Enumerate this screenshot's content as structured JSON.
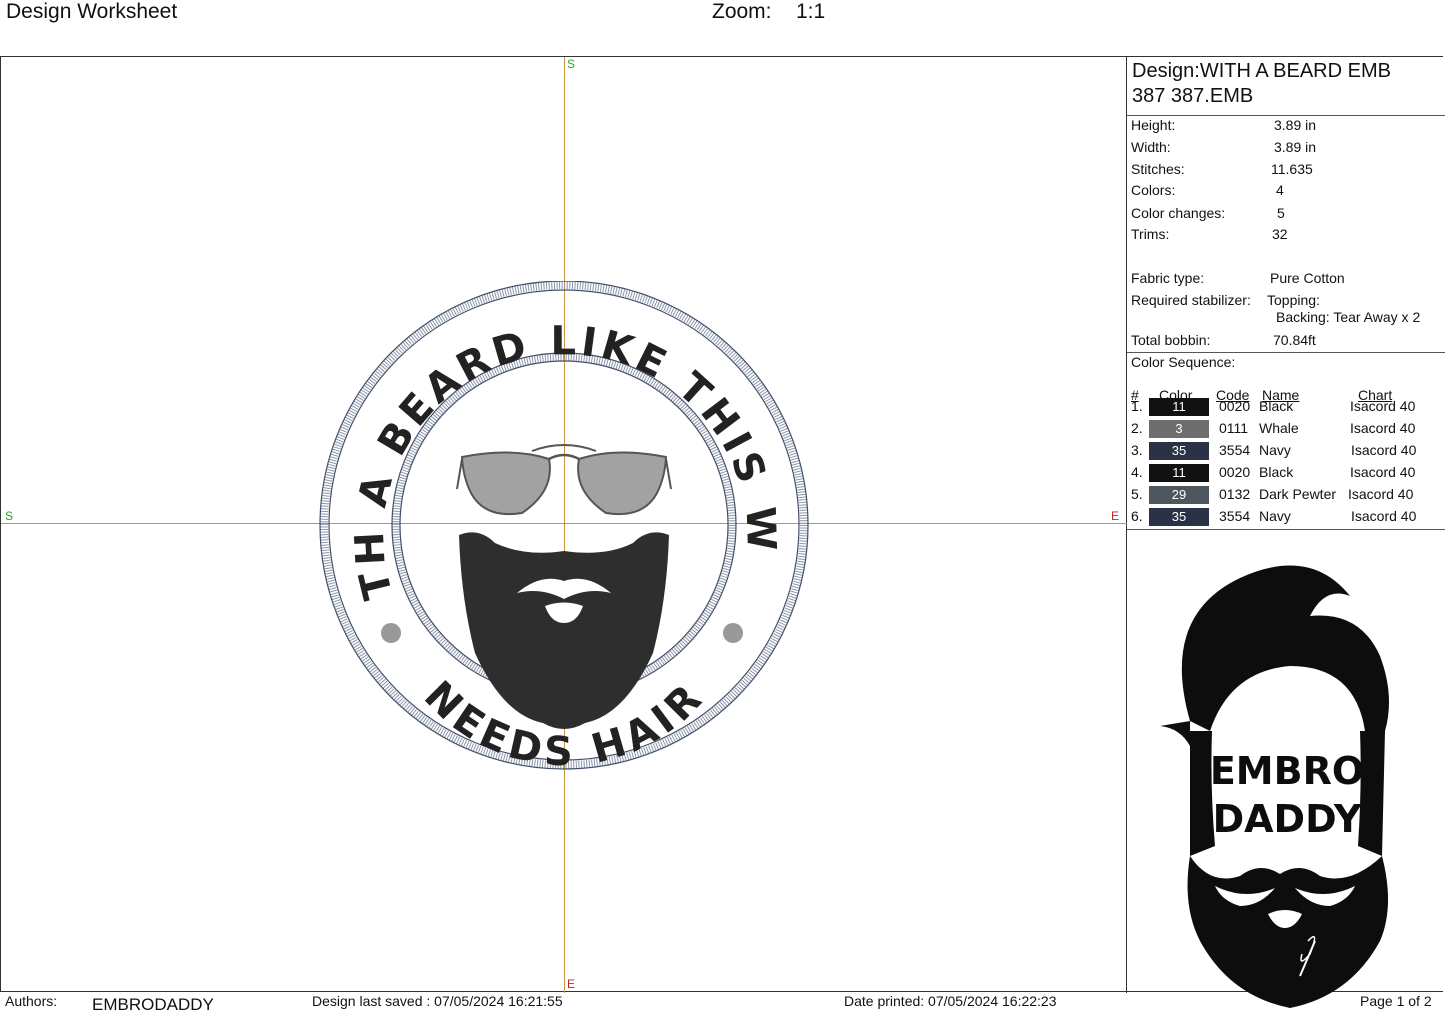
{
  "header": {
    "title": "Design Worksheet",
    "zoom_label": "Zoom:",
    "zoom_value": "1:1"
  },
  "canvas": {
    "start_marker": "S",
    "end_marker": "E",
    "design_text_top": "WITH A BEARD LIKE THIS WHO",
    "design_text_bottom": "NEEDS HAIR"
  },
  "panel": {
    "design_line1": "Design:WITH A BEARD EMB",
    "design_line2": "387 387.EMB",
    "properties": [
      {
        "label": "Height:",
        "value": "3.89 in"
      },
      {
        "label": "Width:",
        "value": "3.89 in"
      },
      {
        "label": "Stitches:",
        "value": "11.635"
      },
      {
        "label": "Colors:",
        "value": "4"
      },
      {
        "label": "Color changes:",
        "value": "5"
      },
      {
        "label": "Trims:",
        "value": "32"
      }
    ],
    "fabric_label": "Fabric type:",
    "fabric_value": "Pure Cotton",
    "stabilizer_label": "Required stabilizer:",
    "topping": "Topping:",
    "backing": "Backing: Tear Away x 2",
    "bobbin_label": "Total bobbin:",
    "bobbin_value": "70.84ft",
    "sequence_title": "Color Sequence:",
    "sequence_headers": {
      "num": "#",
      "color": "Color",
      "code": "Code",
      "name": "Name",
      "chart": "Chart"
    },
    "sequence": [
      {
        "num": "1.",
        "swatch": "11",
        "swatch_color": "#111111",
        "code": "0020",
        "name": "Black",
        "chart": "Isacord 40"
      },
      {
        "num": "2.",
        "swatch": "3",
        "swatch_color": "#6e6e6e",
        "code": "0111",
        "name": "Whale",
        "chart": "Isacord 40"
      },
      {
        "num": "3.",
        "swatch": "35",
        "swatch_color": "#2a3346",
        "code": "3554",
        "name": "Navy",
        "chart": "Isacord 40"
      },
      {
        "num": "4.",
        "swatch": "11",
        "swatch_color": "#111111",
        "code": "0020",
        "name": "Black",
        "chart": "Isacord 40"
      },
      {
        "num": "5.",
        "swatch": "29",
        "swatch_color": "#4e565e",
        "code": "0132",
        "name": "Dark Pewter",
        "chart": "Isacord 40"
      },
      {
        "num": "6.",
        "swatch": "35",
        "swatch_color": "#2a3346",
        "code": "3554",
        "name": "Navy",
        "chart": "Isacord 40"
      }
    ],
    "logo_line1": "EMBRO",
    "logo_line2": "DADDY"
  },
  "footer": {
    "authors_label": "Authors:",
    "authors_value": "EMBRODADDY",
    "saved": "Design last saved : 07/05/2024 16:21:55",
    "printed": "Date printed: 07/05/2024 16:22:23",
    "page": "Page 1 of 2"
  }
}
